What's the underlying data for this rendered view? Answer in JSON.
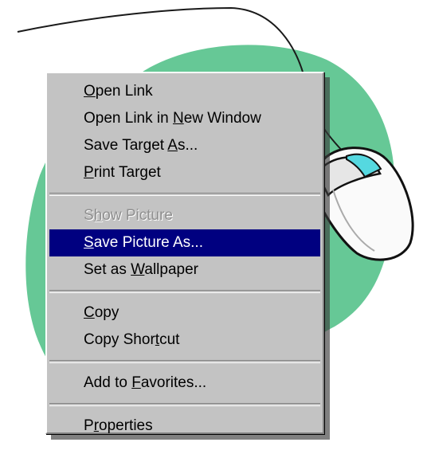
{
  "context_menu": {
    "items": [
      {
        "before": "",
        "accel": "O",
        "after": "pen Link",
        "state": "normal"
      },
      {
        "before": "Open Link in ",
        "accel": "N",
        "after": "ew Window",
        "state": "normal"
      },
      {
        "before": "Save Target ",
        "accel": "A",
        "after": "s...",
        "state": "normal"
      },
      {
        "before": "",
        "accel": "P",
        "after": "rint Target",
        "state": "normal"
      },
      {
        "before": "S",
        "accel": "h",
        "after": "ow Picture",
        "state": "disabled"
      },
      {
        "before": "",
        "accel": "S",
        "after": "ave Picture As...",
        "state": "selected"
      },
      {
        "before": "Set as ",
        "accel": "W",
        "after": "allpaper",
        "state": "normal"
      },
      {
        "before": "",
        "accel": "C",
        "after": "opy",
        "state": "normal"
      },
      {
        "before": "Copy Shor",
        "accel": "t",
        "after": "cut",
        "state": "normal"
      },
      {
        "before": "Add to ",
        "accel": "F",
        "after": "avorites...",
        "state": "normal"
      },
      {
        "before": "P",
        "accel": "r",
        "after": "operties",
        "state": "normal"
      }
    ]
  },
  "colors": {
    "menu_background": "#c3c3c3",
    "highlight": "#000080",
    "blob": "#66c896",
    "mouse_button": "#55d8e0"
  },
  "icons": [
    "mouse-icon",
    "mouse-cable-icon",
    "green-blob-shape"
  ]
}
